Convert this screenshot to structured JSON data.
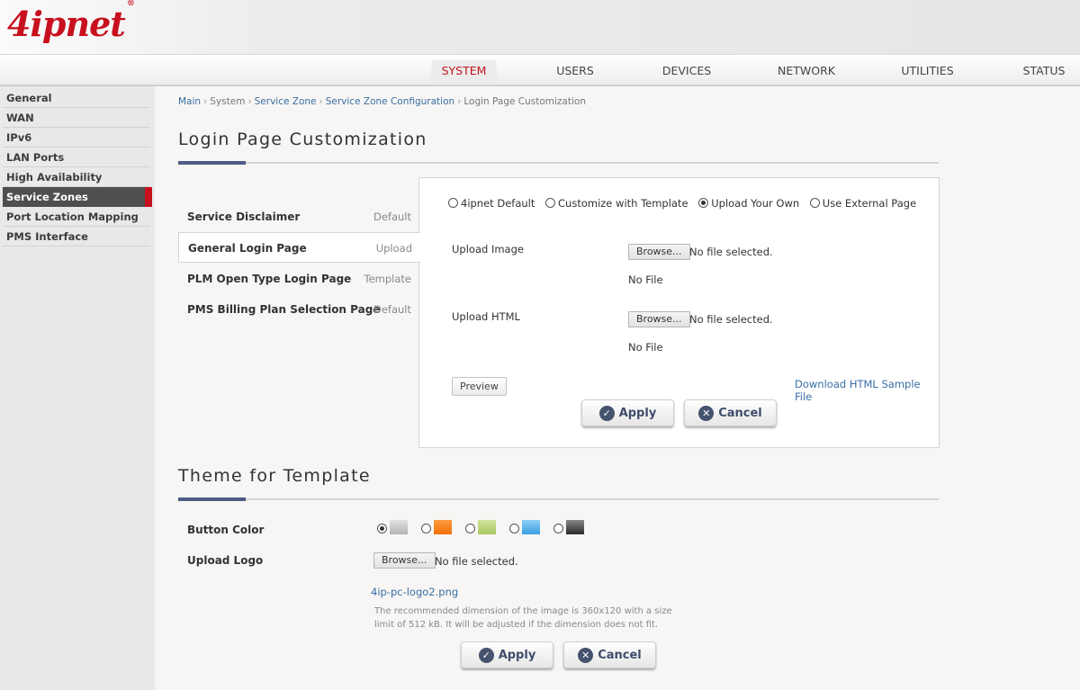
{
  "brand": {
    "logo_text": "4ipnet",
    "registered_mark": "®",
    "color": "#c8101e"
  },
  "nav": {
    "items": [
      {
        "label": "SYSTEM",
        "active": true
      },
      {
        "label": "USERS",
        "active": false
      },
      {
        "label": "DEVICES",
        "active": false
      },
      {
        "label": "NETWORK",
        "active": false
      },
      {
        "label": "UTILITIES",
        "active": false
      },
      {
        "label": "STATUS",
        "active": false
      }
    ]
  },
  "sidebar": {
    "items": [
      {
        "label": "General"
      },
      {
        "label": "WAN"
      },
      {
        "label": "IPv6"
      },
      {
        "label": "LAN Ports"
      },
      {
        "label": "High Availability"
      },
      {
        "label": "Service Zones",
        "active": true
      },
      {
        "label": "Port Location Mapping"
      },
      {
        "label": "PMS Interface"
      }
    ]
  },
  "breadcrumb": {
    "items": [
      "Main",
      "System",
      "Service Zone",
      "Service Zone Configuration",
      "Login Page Customization"
    ],
    "separator": "›"
  },
  "login_section": {
    "title": "Login Page Customization",
    "tabs": [
      {
        "name": "Service Disclaimer",
        "value": "Default"
      },
      {
        "name": "General Login Page",
        "value": "Upload",
        "active": true
      },
      {
        "name": "PLM Open Type Login Page",
        "value": "Template"
      },
      {
        "name": "PMS Billing Plan Selection Page",
        "value": "Default"
      }
    ],
    "mode_options": [
      {
        "label": "4ipnet Default",
        "selected": false
      },
      {
        "label": "Customize with Template",
        "selected": false
      },
      {
        "label": "Upload Your Own",
        "selected": true
      },
      {
        "label": "Use External Page",
        "selected": false
      }
    ],
    "upload_image": {
      "label": "Upload Image",
      "browse_label": "Browse...",
      "file_status": "No file selected.",
      "current": "No File"
    },
    "upload_html": {
      "label": "Upload HTML",
      "browse_label": "Browse...",
      "file_status": "No file selected.",
      "current": "No File"
    },
    "preview_label": "Preview",
    "download_link": "Download HTML Sample File",
    "apply_label": "Apply",
    "cancel_label": "Cancel"
  },
  "theme_section": {
    "title": "Theme for Template",
    "button_color_label": "Button Color",
    "button_colors": [
      {
        "name": "gray",
        "color": "#b5b5b5",
        "selected": true
      },
      {
        "name": "orange",
        "color": "#f07008",
        "selected": false
      },
      {
        "name": "green",
        "color": "#a8c860",
        "selected": false
      },
      {
        "name": "blue",
        "color": "#3aa0e0",
        "selected": false
      },
      {
        "name": "black",
        "color": "#2a2a2a",
        "selected": false
      }
    ],
    "upload_logo_label": "Upload Logo",
    "browse_label": "Browse...",
    "file_status": "No file selected.",
    "current_logo": "4ip-pc-logo2.png",
    "help_text": "The recommended dimension of the image is 360x120 with a size limit of 512 kB. It will be adjusted if the dimension does not fit.",
    "apply_label": "Apply",
    "cancel_label": "Cancel"
  }
}
